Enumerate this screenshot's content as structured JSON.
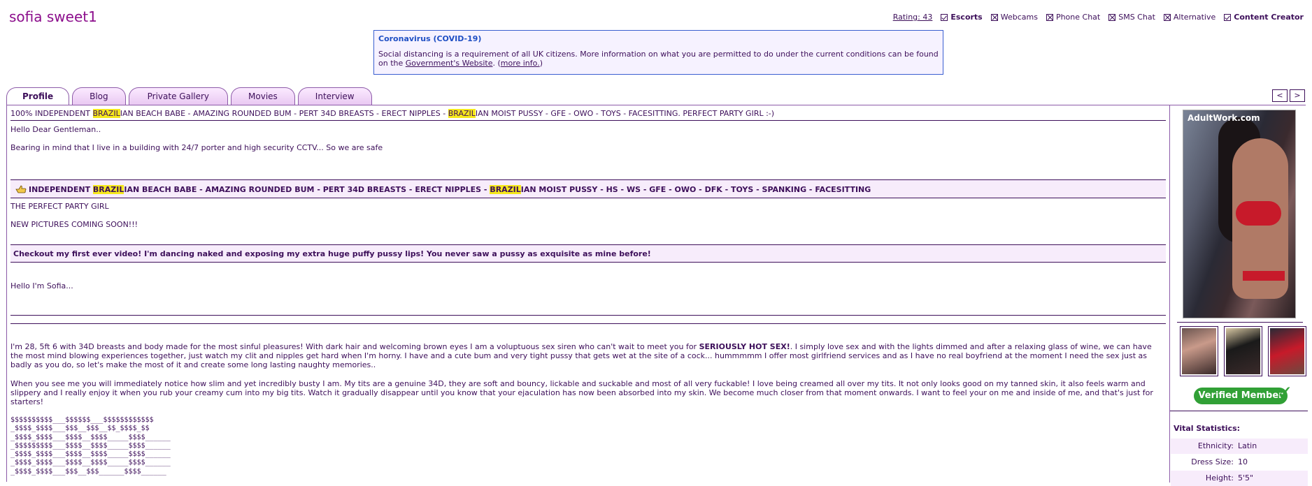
{
  "profile": {
    "username": "sofia sweet1"
  },
  "topnav": {
    "rating": "Rating: 43",
    "items": [
      {
        "label": "Escorts",
        "checked": true,
        "bold": true
      },
      {
        "label": "Webcams",
        "checked": false,
        "bold": false
      },
      {
        "label": "Phone Chat",
        "checked": false,
        "bold": false
      },
      {
        "label": "SMS Chat",
        "checked": false,
        "bold": false
      },
      {
        "label": "Alternative",
        "checked": false,
        "bold": false
      },
      {
        "label": "Content Creator",
        "checked": true,
        "bold": true
      }
    ]
  },
  "notice": {
    "title": "Coronavirus (COVID-19)",
    "text": "Social distancing is a requirement of all UK citizens. More information on what you are permitted to do under the current conditions can be found on the",
    "link_gov": "Government's Website",
    "text2": ". (",
    "link_more": "more info.",
    "text3": ")"
  },
  "tabs": [
    "Profile",
    "Blog",
    "Private Gallery",
    "Movies",
    "Interview"
  ],
  "pager": {
    "prev": "<",
    "next": ">"
  },
  "main": {
    "headline": {
      "a": "100% INDEPENDENT ",
      "hl1": "BRAZIL",
      "b": "IAN BEACH BABE - AMAZING ROUNDED BUM - PERT 34D BREASTS - ERECT NIPPLES - ",
      "hl2": "BRAZIL",
      "c": "IAN MOIST PUSSY - GFE - OWO - TOYS - FACESITTING. PERFECT PARTY GIRL :-)"
    },
    "greeting": "Hello Dear Gentleman..",
    "security": "Bearing in mind that I live in a building with 24/7 porter and high security CCTV... So we are safe",
    "box1": {
      "a": "INDEPENDENT ",
      "hl1": "BRAZIL",
      "b": "IAN BEACH BABE - AMAZING ROUNDED BUM - PERT 34D BREASTS - ERECT NIPPLES - ",
      "hl2": "BRAZIL",
      "c": "IAN MOIST PUSSY - HS - WS - GFE - OWO - DFK - TOYS - SPANKING - FACESITTING"
    },
    "party": "THE PERFECT PARTY GIRL",
    "newpics": "NEW PICTURES COMING SOON!!!",
    "box2": "Checkout my first ever video! I'm dancing naked and exposing my extra huge puffy pussy lips! You never saw a pussy as exquisite as mine before!",
    "hello": "Hello I'm Sofia...",
    "para1a": "I'm 28, 5ft 6 with 34D breasts and body made for the most sinful pleasures! With dark hair and welcoming brown eyes I am a voluptuous sex siren who can't wait to meet you for ",
    "para1b": "SERIOUSLY HOT SEX!",
    "para1c": ". I simply love sex and with the lights dimmed and after a relaxing glass of wine, we can have the most mind blowing experiences together, just watch my clit and nipples get hard when I'm horny. I have and a cute bum and very tight pussy that gets wet at the site of a cock... hummmmm I offer most girlfriend services and as I have no real boyfriend at the moment I need the sex just as badly as you do, so let's make the most of it and create some long lasting naughty memories..",
    "para2": "When you see me you will immediately notice how slim and yet incredibly busty I am. My tits are a genuine 34D, they are soft and bouncy, lickable and suckable and most of all very fuckable! I love being creamed all over my tits. It not only looks good on my tanned skin, it also feels warm and slippery and I really enjoy it when you rub your creamy cum into my big tits. Watch it gradually disappear until you know that your ejaculation has now been absorbed into my skin. We become much closer from that moment onwards. I want to feel your on me and inside of me, and that's just for starters!",
    "dollar_art": "$$$$$$$$$$___$$$$$$___$$$$$$$$$$$$\n_$$$$_$$$$___$$$__$$$__$$_$$$$_$$\n_$$$$_$$$$___$$$$__$$$$_____$$$$______\n_$$$$$$$$$___$$$$__$$$$_____$$$$______\n_$$$$_$$$$___$$$$__$$$$_____$$$$______\n_$$$$_$$$$___$$$$__$$$$_____$$$$______\n_$$$$_$$$$___$$$__$$$______$$$$______"
  },
  "side": {
    "watermark": "AdultWork.com",
    "verified": "Verified Member",
    "vital_title": "Vital Statistics:",
    "stats": [
      {
        "label": "Ethnicity:",
        "value": "Latin"
      },
      {
        "label": "Dress Size:",
        "value": "10"
      },
      {
        "label": "Height:",
        "value": "5'5\""
      }
    ]
  },
  "colors": {
    "text": "#3d0f5a",
    "username": "#8c0e8c",
    "highlight": "#f5e81c",
    "notice_title": "#1f4fc4",
    "verified": "#31a036"
  }
}
